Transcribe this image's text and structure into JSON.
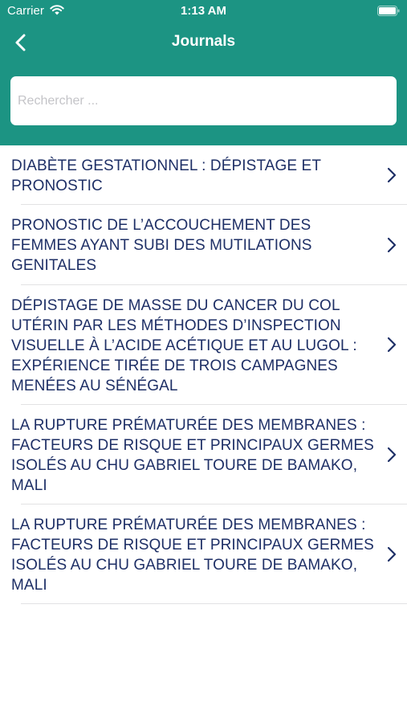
{
  "status_bar": {
    "carrier": "Carrier",
    "time": "1:13 AM"
  },
  "nav": {
    "title": "Journals",
    "back_icon": "chevron-left-icon"
  },
  "search": {
    "placeholder": "Rechercher ...",
    "value": ""
  },
  "journals": [
    {
      "title": "DIABÈTE GESTATIONNEL : DÉPISTAGE ET PRONOSTIC"
    },
    {
      "title": "PRONOSTIC DE L’ACCOUCHEMENT DES FEMMES AYANT SUBI DES MUTILATIONS GENITALES"
    },
    {
      "title": "DÉPISTAGE DE MASSE DU CANCER DU COL UTÉRIN PAR LES MÉTHODES D’INSPECTION VISUELLE À L’ACIDE ACÉTIQUE ET AU LUGOL : EXPÉRIENCE TIRÉE DE TROIS CAMPAGNES MENÉES AU SÉNÉGAL"
    },
    {
      "title": "LA RUPTURE PRÉMATURÉE DES MEMBRANES : FACTEURS DE RISQUE ET PRINCIPAUX GERMES ISOLÉS AU CHU GABRIEL TOURE DE BAMAKO, MALI"
    },
    {
      "title": "LA RUPTURE PRÉMATURÉE DES MEMBRANES : FACTEURS DE RISQUE ET PRINCIPAUX GERMES ISOLÉS AU CHU GABRIEL TOURE DE BAMAKO, MALI"
    }
  ],
  "colors": {
    "header": "#1c9483",
    "text": "#1e2f66",
    "chevron": "#1e2f66"
  }
}
